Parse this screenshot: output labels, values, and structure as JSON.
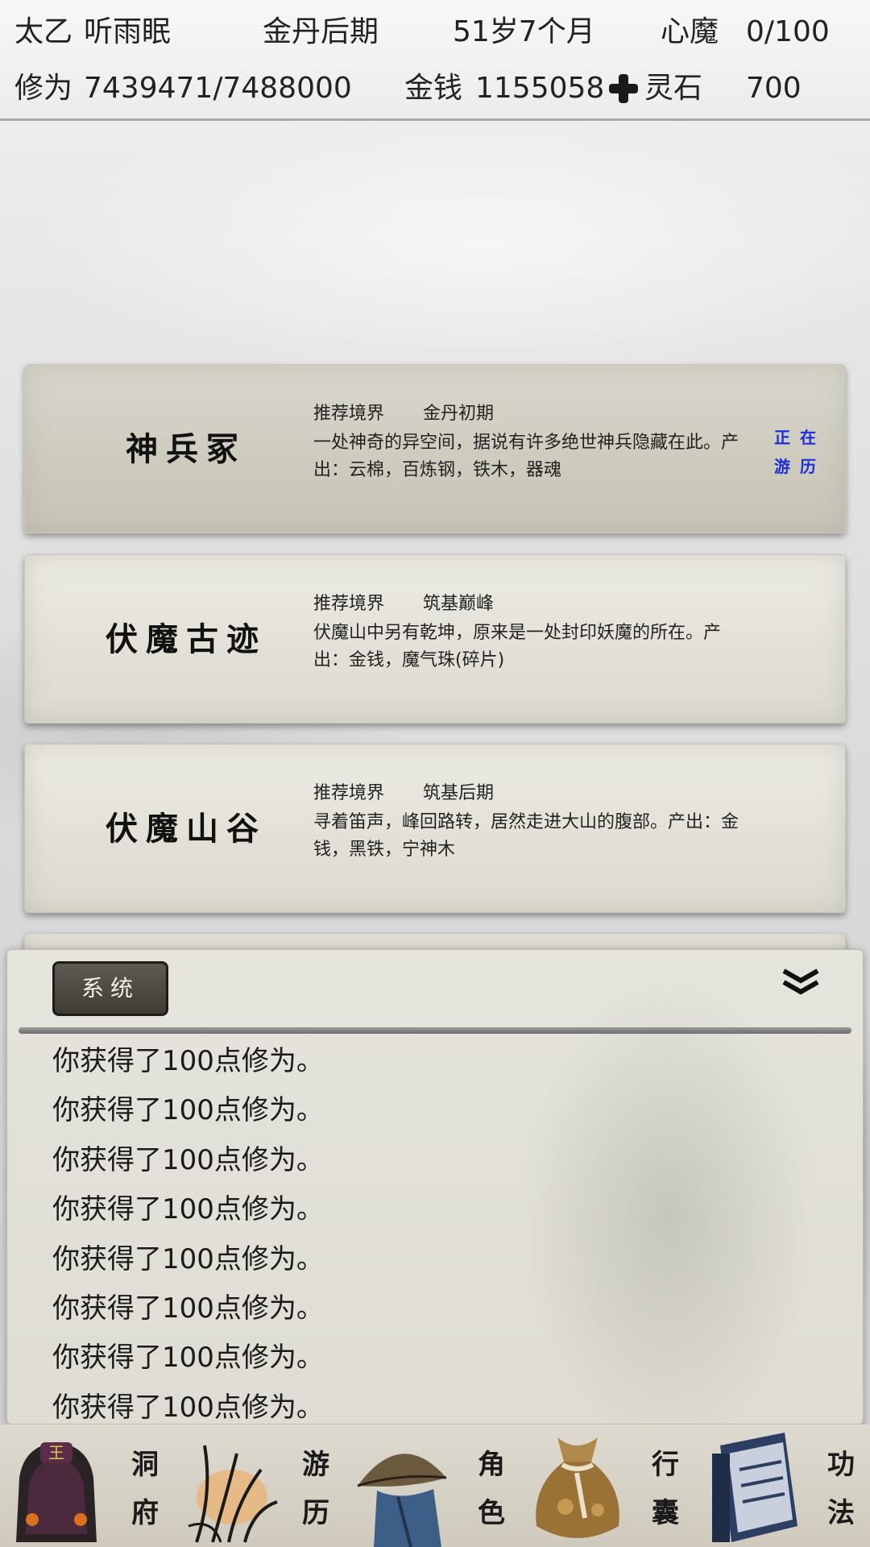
{
  "header": {
    "sect": "太乙",
    "name": "听雨眠",
    "realm": "金丹后期",
    "age": "51岁7个月",
    "demon_label": "心魔",
    "demon_value": "0/100",
    "cultivation_label": "修为",
    "cultivation_value": "7439471/7488000",
    "money_label": "金钱",
    "money_value": "1155058",
    "spirit_stone_label": "灵石",
    "spirit_stone_value": "700"
  },
  "cards": [
    {
      "name": "神兵冢",
      "realm_label": "推荐境界",
      "realm_value": "金丹初期",
      "desc": "一处神奇的异空间，据说有许多绝世神兵隐藏在此。产出：云棉，百炼钢，铁木，器魂",
      "status": "正在游历"
    },
    {
      "name": "伏魔古迹",
      "realm_label": "推荐境界",
      "realm_value": "筑基巅峰",
      "desc": "伏魔山中另有乾坤，原来是一处封印妖魔的所在。产出：金钱，魔气珠(碎片)"
    },
    {
      "name": "伏魔山谷",
      "realm_label": "推荐境界",
      "realm_value": "筑基后期",
      "desc": "寻着笛声，峰回路转，居然走进大山的腹部。产出：金钱，黑铁，宁神木"
    }
  ],
  "log": {
    "tab_label": "系统",
    "messages": [
      "你获得了100点修为。",
      "你获得了100点修为。",
      "你获得了100点修为。",
      "你获得了100点修为。",
      "你获得了100点修为。",
      "你获得了100点修为。",
      "你获得了100点修为。",
      "你获得了100点修为。"
    ]
  },
  "nav": [
    {
      "label": "洞府",
      "icon": "cave-dwelling-icon"
    },
    {
      "label": "游历",
      "icon": "travel-grass-icon",
      "active": true
    },
    {
      "label": "角色",
      "icon": "straw-hat-character-icon"
    },
    {
      "label": "行囊",
      "icon": "bag-icon"
    },
    {
      "label": "功法",
      "icon": "scroll-book-icon"
    }
  ],
  "colors": {
    "status_blue": "#1c2fd6",
    "tab_dark": "#4a4640"
  }
}
